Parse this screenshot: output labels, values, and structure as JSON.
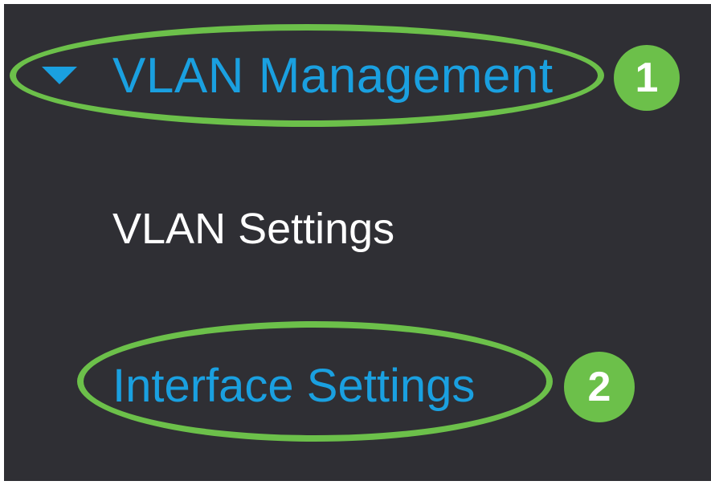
{
  "menu": {
    "vlan_management": {
      "label": "VLAN Management",
      "expanded": true,
      "caret_icon": "caret-down-icon",
      "step_badge": "1"
    },
    "children": [
      {
        "label": "VLAN Settings"
      },
      {
        "label": "Interface Settings",
        "step_badge": "2"
      }
    ]
  },
  "colors": {
    "background": "#2f2f34",
    "link_blue": "#1aa0e0",
    "text_white": "#ffffff",
    "highlight_green": "#6cc04a"
  }
}
